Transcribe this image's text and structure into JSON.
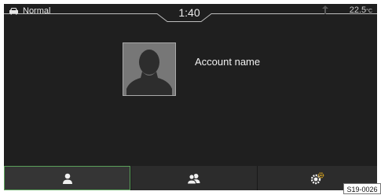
{
  "status": {
    "drive_mode": "Normal",
    "drive_mode_icon": "car-icon",
    "time": "1:40",
    "temperature_value": "22.5",
    "temperature_unit": "°C",
    "signal_icon": "signal-icon"
  },
  "profile": {
    "account_name": "Account name",
    "photo_icon": "person-silhouette-icon"
  },
  "tabs": [
    {
      "icon": "user-icon",
      "active": true
    },
    {
      "icon": "users-icon",
      "active": false
    },
    {
      "icon": "user-settings-icon",
      "active": false
    }
  ],
  "colors": {
    "background": "#1f1f1f",
    "tabbar": "#2c2c2c",
    "active_tab_border": "#5aa05a",
    "text": "#f2f2f2"
  },
  "figure_code": "S19-0026"
}
